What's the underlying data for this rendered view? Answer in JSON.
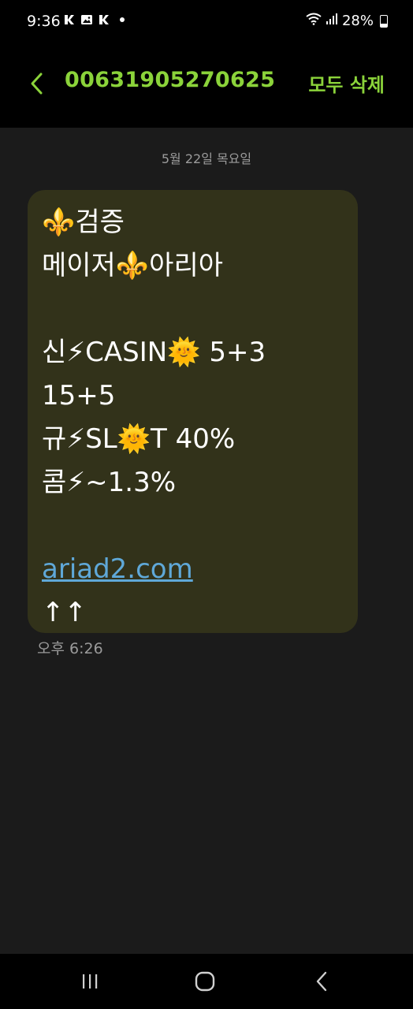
{
  "status_bar": {
    "time": "9:36",
    "battery": "28%",
    "left_icons": [
      "sync-icon",
      "gallery-icon",
      "sync-icon"
    ],
    "right_icons": [
      "wifi-icon",
      "signal-icon",
      "battery-icon"
    ]
  },
  "header": {
    "title": "00631905270625",
    "delete_all": "모두 삭제",
    "accent_color": "#8bd33a"
  },
  "conversation": {
    "date": "5월 22일 목요일",
    "message": {
      "lines": [
        "⚜️검증",
        "메이저⚜️아리아",
        "",
        "신⚡CASIN🌞 5+3",
        "15+5",
        "규⚡SL🌞T 40%",
        "콤⚡~1.3%",
        "",
        "ariad2.com",
        "↑↑"
      ],
      "link": "ariad2.com",
      "time": "오후 6:26",
      "bubble_color": "#32321a",
      "link_color": "#5fa8d8"
    }
  },
  "nav_bar": {
    "buttons": [
      "recents-icon",
      "home-icon",
      "back-icon"
    ]
  }
}
